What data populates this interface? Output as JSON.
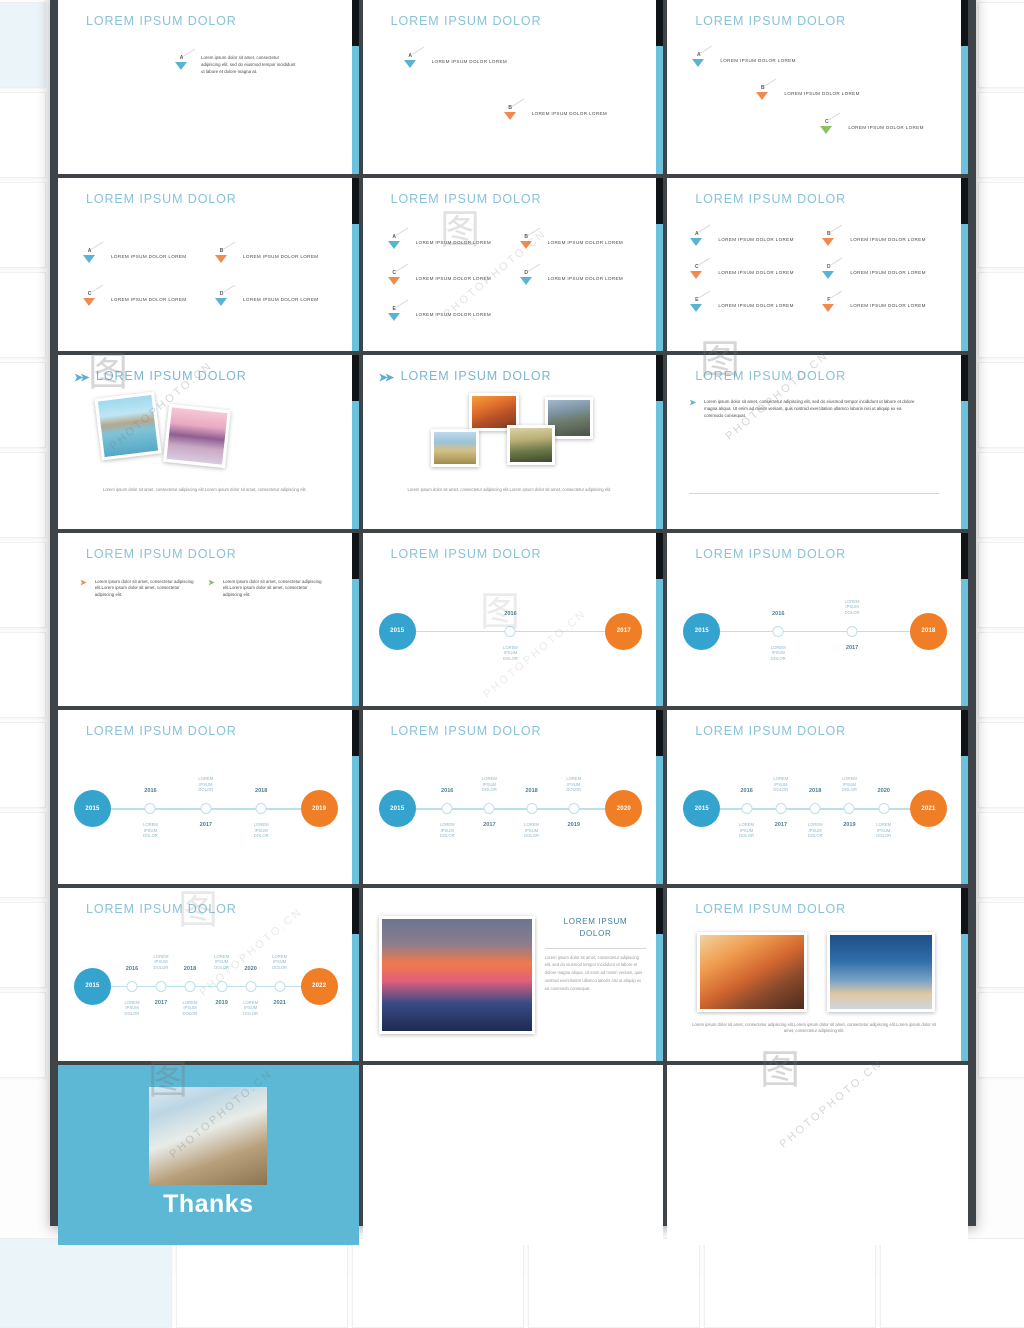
{
  "deck": {
    "title_text": "LOREM IPSUM DOLOR",
    "thanks_label": "Thanks",
    "accent_blue": "#6cc1dc",
    "accent_orange": "#f07e26",
    "accent_cyan": "#34a3ce",
    "title_color": "#89c2d9",
    "panel_color": "#3f4448"
  },
  "watermark": {
    "text": "PHOTOPHOTO.CN",
    "mark": "图"
  },
  "bullet_labels": {
    "short": "LOREM IPSUM DOLOR LOREM",
    "paragraph": "Lorem ipsum dolor sit amet, consectetur adipiscing elit, sed do eiusmod tempor incididunt ut labore et dolore magna at.",
    "long_paragraph": "Lorem ipsum dolor sit amet, consectetur adipiscing elit, sed do eiusmod tempor incididunt ut labore et dolore magna aliqua. Ut enim ad minim veniam, quis nostrud exercitation ullamco laboris nisi ut aliquip ex ea commodo consequat.",
    "chevron_paragraph": "Lorem ipsum dolor sit amet, consectetur adipiscing elit.Lorem ipsum dolor sit amet, consectetur adipiscing elit.",
    "photo_caption": "Lorem ipsum dolor sit amet, consectetur adipiscing elit.Lorem ipsum dolor sit amet, consectetur adipiscing elit.",
    "photo_caption_two": "Lorem ipsum dolor sit amet, consectetur adipiscing elit.Lorem ipsum dolor sit amet, consectetur adipiscing elit.Lorem ipsum dolor sit amet, consectetur adipiscing elit.",
    "side_body": "Lorem ipsum dolor sit amet, consectetur adipiscing elit, sed do eiusmod tempor incididunt ut labore et dolore magna aliqua. Ut enim ad minim veniam, quis nostrud exercitation ullamco laboris nisi ut aliquip ex ea commodo consequat.",
    "timeline_label": "LOREM IPSUM DOLOR",
    "letters": [
      "A",
      "B",
      "C",
      "D",
      "E",
      "F"
    ]
  },
  "slides": [
    {
      "id": 1,
      "title": "LOREM IPSUM DOLOR",
      "type": "bullets-paragraph",
      "bullets": 1
    },
    {
      "id": 2,
      "title": "LOREM IPSUM DOLOR",
      "type": "bullets-stagger",
      "bullets": 2
    },
    {
      "id": 3,
      "title": "LOREM IPSUM DOLOR",
      "type": "bullets-stagger",
      "bullets": 3
    },
    {
      "id": 4,
      "title": "LOREM IPSUM DOLOR",
      "type": "bullets-grid",
      "bullets": 4
    },
    {
      "id": 5,
      "title": "LOREM IPSUM DOLOR",
      "type": "bullets-grid",
      "bullets": 5
    },
    {
      "id": 6,
      "title": "LOREM IPSUM DOLOR",
      "type": "bullets-grid",
      "bullets": 6
    },
    {
      "id": 7,
      "title": "LOREM IPSUM DOLOR",
      "type": "photos-two"
    },
    {
      "id": 8,
      "title": "LOREM IPSUM DOLOR",
      "type": "photos-cluster"
    },
    {
      "id": 9,
      "title": "LOREM IPSUM DOLOR",
      "type": "text-block"
    },
    {
      "id": 10,
      "title": "LOREM IPSUM DOLOR",
      "type": "chevron-columns"
    },
    {
      "id": 11,
      "title": "LOREM IPSUM DOLOR",
      "type": "timeline"
    },
    {
      "id": 12,
      "title": "LOREM IPSUM DOLOR",
      "type": "timeline"
    },
    {
      "id": 13,
      "title": "LOREM IPSUM DOLOR",
      "type": "timeline"
    },
    {
      "id": 14,
      "title": "LOREM IPSUM DOLOR",
      "type": "timeline"
    },
    {
      "id": 15,
      "title": "LOREM IPSUM DOLOR",
      "type": "timeline"
    },
    {
      "id": 16,
      "title": "LOREM IPSUM DOLOR",
      "type": "timeline"
    },
    {
      "id": 17,
      "title": "LOREM IPSUM DOLOR",
      "type": "photo-side-text"
    },
    {
      "id": 18,
      "title": "LOREM IPSUM DOLOR",
      "type": "photos-pair"
    },
    {
      "id": 19,
      "title": "Thanks",
      "type": "thanks"
    },
    {
      "id": 20,
      "title": "",
      "type": "blank"
    },
    {
      "id": 21,
      "title": "",
      "type": "blank"
    }
  ],
  "timelines": [
    {
      "slide": 11,
      "start_year": "2015",
      "end_year": "2017",
      "mid_years": [
        "2016"
      ],
      "labels": [
        "LOREM IPSUM DOLOR"
      ]
    },
    {
      "slide": 12,
      "start_year": "2015",
      "end_year": "2018",
      "mid_years": [
        "2016",
        "2017"
      ],
      "labels": [
        "LOREM IPSUM DOLOR",
        "LOREM IPSUM DOLOR"
      ]
    },
    {
      "slide": 13,
      "start_year": "2015",
      "end_year": "2019",
      "mid_years": [
        "2016",
        "2017",
        "2018"
      ],
      "labels": [
        "LOREM IPSUM DOLOR",
        "LOREM IPSUM DOLOR",
        "LOREM IPSUM DOLOR"
      ]
    },
    {
      "slide": 14,
      "start_year": "2015",
      "end_year": "2020",
      "mid_years": [
        "2016",
        "2017",
        "2018",
        "2019"
      ],
      "labels": [
        "LOREM IPSUM DOLOR",
        "LOREM IPSUM DOLOR",
        "LOREM IPSUM DOLOR",
        "LOREM IPSUM DOLOR"
      ]
    },
    {
      "slide": 15,
      "start_year": "2015",
      "end_year": "2021",
      "mid_years": [
        "2016",
        "2017",
        "2018",
        "2019",
        "2020"
      ],
      "labels": [
        "LOREM IPSUM DOLOR",
        "LOREM IPSUM DOLOR",
        "LOREM IPSUM DOLOR",
        "LOREM IPSUM DOLOR",
        "LOREM IPSUM DOLOR"
      ]
    },
    {
      "slide": 16,
      "start_year": "2015",
      "end_year": "2022",
      "mid_years": [
        "2016",
        "2017",
        "2018",
        "2019",
        "2020",
        "2021"
      ],
      "labels": [
        "LOREM IPSUM DOLOR",
        "LOREM IPSUM DOLOR",
        "LOREM IPSUM DOLOR",
        "LOREM IPSUM DOLOR",
        "LOREM IPSUM DOLOR",
        "LOREM IPSUM DOLOR"
      ]
    }
  ],
  "side_slide": {
    "title_line1": "LOREM IPSUM",
    "title_line2": "DOLOR"
  }
}
